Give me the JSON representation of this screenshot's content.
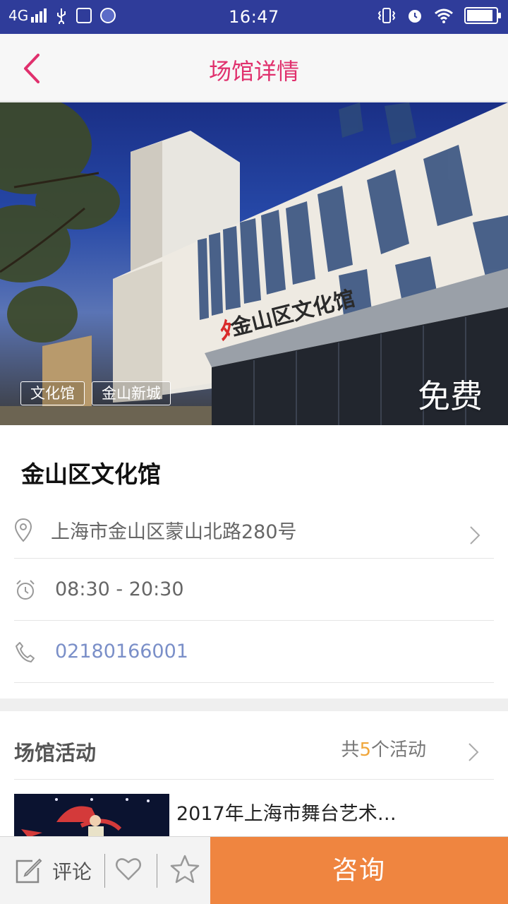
{
  "status_bar": {
    "network": "4G",
    "time": "16:47"
  },
  "header": {
    "title": "场馆详情",
    "back_icon": "chevron-left-icon"
  },
  "hero": {
    "building_sign": "金山区文化馆",
    "tags": [
      "文化馆",
      "金山新城"
    ],
    "price": "免费"
  },
  "venue": {
    "name": "金山区文化馆",
    "address": "上海市金山区蒙山北路280号",
    "hours": "08:30 - 20:30",
    "phone": "02180166001"
  },
  "activities": {
    "section_title": "场馆活动",
    "count_prefix": "共",
    "count": "5",
    "count_suffix": "个活动",
    "items": [
      {
        "title": "2017年上海市舞台艺术…"
      }
    ]
  },
  "bottom_bar": {
    "comment_label": "评论",
    "consult_label": "咨询"
  },
  "colors": {
    "status_bar": "#2f3c9a",
    "accent_pink": "#e0306d",
    "phone_link": "#7a8fc8",
    "count_highlight": "#f0a63a",
    "consult_button": "#ef8540"
  }
}
